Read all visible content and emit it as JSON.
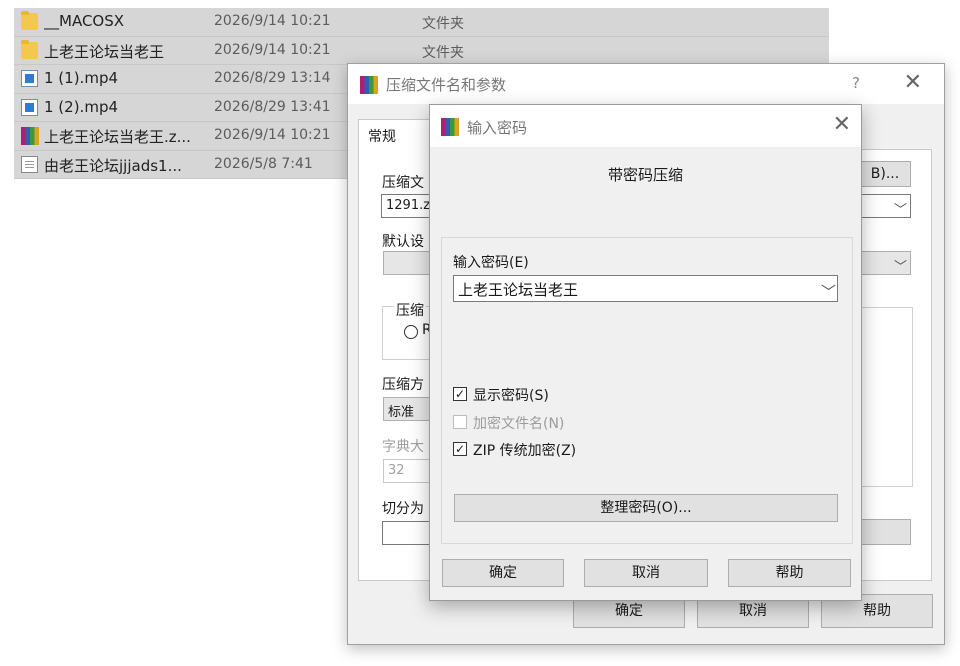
{
  "files": [
    {
      "name": "__MACOSX",
      "date": "2026/9/14 10:21",
      "type": "文件夹",
      "icon": "folder-icon"
    },
    {
      "name": "上老王论坛当老王",
      "date": "2026/9/14 10:21",
      "type": "文件夹",
      "icon": "folder-icon"
    },
    {
      "name": "1 (1).mp4",
      "date": "2026/8/29 13:14",
      "type": "",
      "icon": "video-icon"
    },
    {
      "name": "1 (2).mp4",
      "date": "2026/8/29 13:41",
      "type": "",
      "icon": "video-icon"
    },
    {
      "name": "上老王论坛当老王.z...",
      "date": "2026/9/14 10:21",
      "type": "",
      "icon": "rar-archive-icon"
    },
    {
      "name": "由老王论坛jjjads1...",
      "date": "2026/5/8 7:41",
      "type": "",
      "icon": "text-file-icon"
    }
  ],
  "back_dialog": {
    "title": "压缩文件名和参数",
    "help_symbol": "?",
    "close_symbol": "✕",
    "tab_general": "常规",
    "archive_name_label": "压缩文",
    "archive_name_value": "1291.z",
    "browse_button": "B)...",
    "profile_label": "默认设",
    "format_group_label": "压缩",
    "format_radio_label": "R",
    "method_label": "压缩方",
    "method_value": "标准",
    "dict_label": "字典大",
    "dict_value": "32",
    "split_label": "切分为",
    "ok_button": "确定",
    "cancel_button": "取消",
    "help_button": "帮助"
  },
  "password_dialog": {
    "title": "输入密码",
    "close_symbol": "✕",
    "heading": "带密码压缩",
    "password_label": "输入密码(E)",
    "password_value": "上老王论坛当老王",
    "show_password": {
      "label": "显示密码(S)",
      "checked": true,
      "enabled": true
    },
    "encrypt_names": {
      "label": "加密文件名(N)",
      "checked": false,
      "enabled": false
    },
    "zip_legacy": {
      "label": "ZIP 传统加密(Z)",
      "checked": true,
      "enabled": true
    },
    "organize_button": "整理密码(O)...",
    "ok_button": "确定",
    "cancel_button": "取消",
    "help_button": "帮助"
  }
}
